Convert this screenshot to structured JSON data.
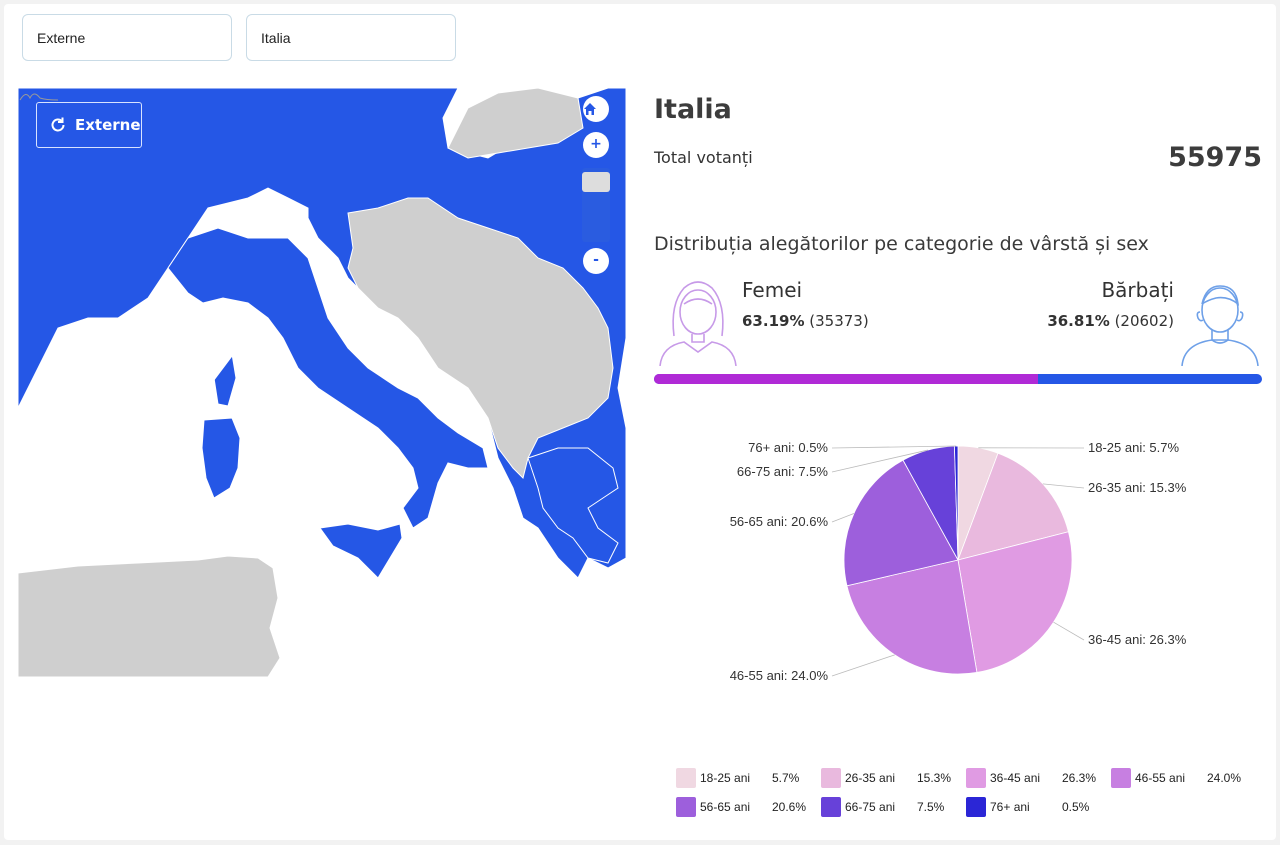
{
  "filters": {
    "region_select": "Externe",
    "country_select": "Italia"
  },
  "map": {
    "reset_button_label": "Externe",
    "zoom_in_label": "+",
    "zoom_out_label": "-",
    "highlight_color": "#2557e6",
    "land_color": "#cfcfcf"
  },
  "summary": {
    "country": "Italia",
    "total_label": "Total votanți",
    "total_value": "55975",
    "distribution_title": "Distribuția alegătorilor pe categorie de vârstă și sex"
  },
  "gender": {
    "female_label": "Femei",
    "female_percent": "63.19%",
    "female_count": "(35373)",
    "female_share": 0.6319,
    "male_label": "Bărbați",
    "male_percent": "36.81%",
    "male_count": "(20602)",
    "female_color": "#b02ad6",
    "male_color": "#2557e6"
  },
  "chart_data": {
    "type": "pie",
    "categories": [
      "18-25 ani",
      "26-35 ani",
      "36-45 ani",
      "46-55 ani",
      "56-65 ani",
      "66-75 ani",
      "76+ ani"
    ],
    "values": [
      5.7,
      15.3,
      26.3,
      24.0,
      20.6,
      7.5,
      0.5
    ],
    "labels": [
      "18-25 ani: 5.7%",
      "26-35 ani: 15.3%",
      "36-45 ani: 26.3%",
      "46-55 ani: 24.0%",
      "56-65 ani: 20.6%",
      "66-75 ani: 7.5%",
      "76+ ani: 0.5%"
    ],
    "legend_percents": [
      "5.7%",
      "15.3%",
      "26.3%",
      "24.0%",
      "20.6%",
      "7.5%",
      "0.5%"
    ],
    "colors": [
      "#f0d8e2",
      "#e9b9de",
      "#e09be3",
      "#c77fe1",
      "#9d5fdc",
      "#6741d9",
      "#2b26d6"
    ],
    "legend_position": "bottom"
  }
}
